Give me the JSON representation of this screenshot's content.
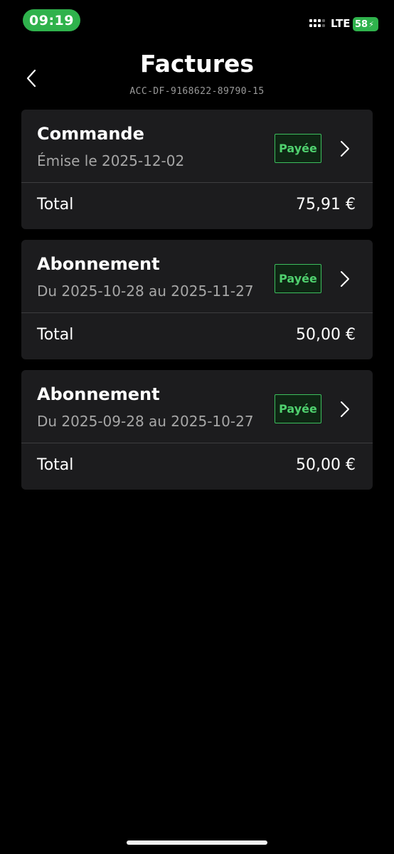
{
  "status_bar": {
    "time": "09:19",
    "network": "LTE",
    "battery": "58",
    "accent_color": "#2fb24c"
  },
  "header": {
    "title": "Factures",
    "account_id": "ACC-DF-9168622-89790-15",
    "back_icon": "chevron-left-icon"
  },
  "invoices": [
    {
      "type": "Commande",
      "date_text": "Émise le 2025-12-02",
      "status": "Payée",
      "total_label": "Total",
      "total": "75,91 €"
    },
    {
      "type": "Abonnement",
      "date_text": "Du 2025-10-28 au 2025-11-27",
      "status": "Payée",
      "total_label": "Total",
      "total": "50,00 €"
    },
    {
      "type": "Abonnement",
      "date_text": "Du 2025-09-28 au 2025-10-27",
      "status": "Payée",
      "total_label": "Total",
      "total": "50,00 €"
    }
  ],
  "colors": {
    "background": "#000000",
    "card": "#1c1c1e",
    "paid_badge": "#4fd06e"
  }
}
